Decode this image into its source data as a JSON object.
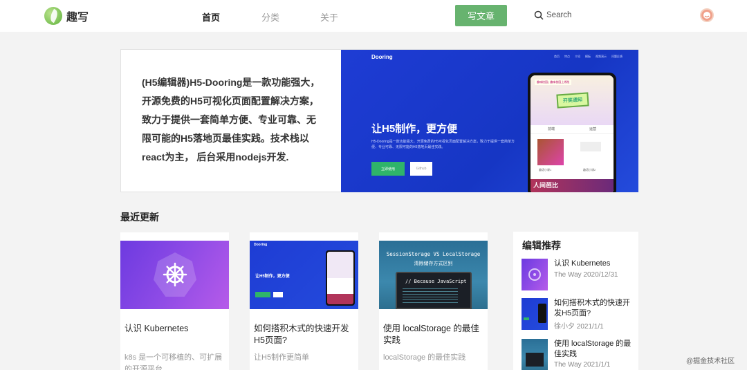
{
  "header": {
    "logo_text": "趣写",
    "nav": [
      "首页",
      "分类",
      "关于"
    ],
    "write_button": "写文章",
    "search_label": "Search"
  },
  "banner": {
    "description": "(H5编辑器)H5-Dooring是一款功能强大，开源免费的H5可视化页面配置解决方案，致力于提供一套简单方便、专业可靠、无限可能的H5落地页最佳实践。技术栈以react为主， 后台采用nodejs开发.",
    "image": {
      "logo": "Dooring",
      "menu": [
        "首页",
        "特点",
        "介绍",
        "模板",
        "视频演示",
        "问题反馈"
      ],
      "title": "让H5制作，更方便",
      "desc": "H5-Dooring是一款功能强大，开源免费的H5可视化页面配置解决方案，致力于提供一套简单方便、专业可靠、无限可能的H5落地页最佳实践。",
      "btn_primary": "立即使用",
      "btn_secondary": "Github",
      "phone": {
        "tag": "趣味校园 | 趣味校园上线啦",
        "badge": "开奖通知",
        "tabs": [
          "前端",
          "运营"
        ],
        "card_label_1": "趣语小课1",
        "card_label_2": "趣语小课2",
        "bottom_text": "人间芭比"
      }
    }
  },
  "recent": {
    "title": "最近更新",
    "cards": [
      {
        "title": "认识 Kubernetes",
        "desc": "k8s 是一个可移植的、可扩展的开源平台"
      },
      {
        "title": "如何搭积木式的快速开发H5页面?",
        "desc": "让H5制作更简单",
        "img": {
          "logo": "Dooring",
          "title": "让H5制作，更方便"
        }
      },
      {
        "title": "使用 localStorage 的最佳实践",
        "desc": "localStorage 的最佳实践",
        "img": {
          "title": "SessionStorage VS LocalStorage",
          "subtitle": "清除储存方式区别",
          "code": "// Because JavaScript"
        }
      }
    ]
  },
  "recommend": {
    "title": "编辑推荐",
    "items": [
      {
        "title": "认识 Kubernetes",
        "author": "The Way",
        "date": "2020/12/31"
      },
      {
        "title": "如何搭积木式的快速开发H5页面?",
        "author": "徐小夕",
        "date": "2021/1/1"
      },
      {
        "title": "使用 localStorage 的最佳实践",
        "author": "The Way",
        "date": "2021/1/1"
      }
    ]
  },
  "watermark": "@掘金技术社区",
  "colors": {
    "accent": "#67b36f",
    "banner_blue": "#1e3cd4",
    "k8s_purple": "#8e4be6"
  }
}
